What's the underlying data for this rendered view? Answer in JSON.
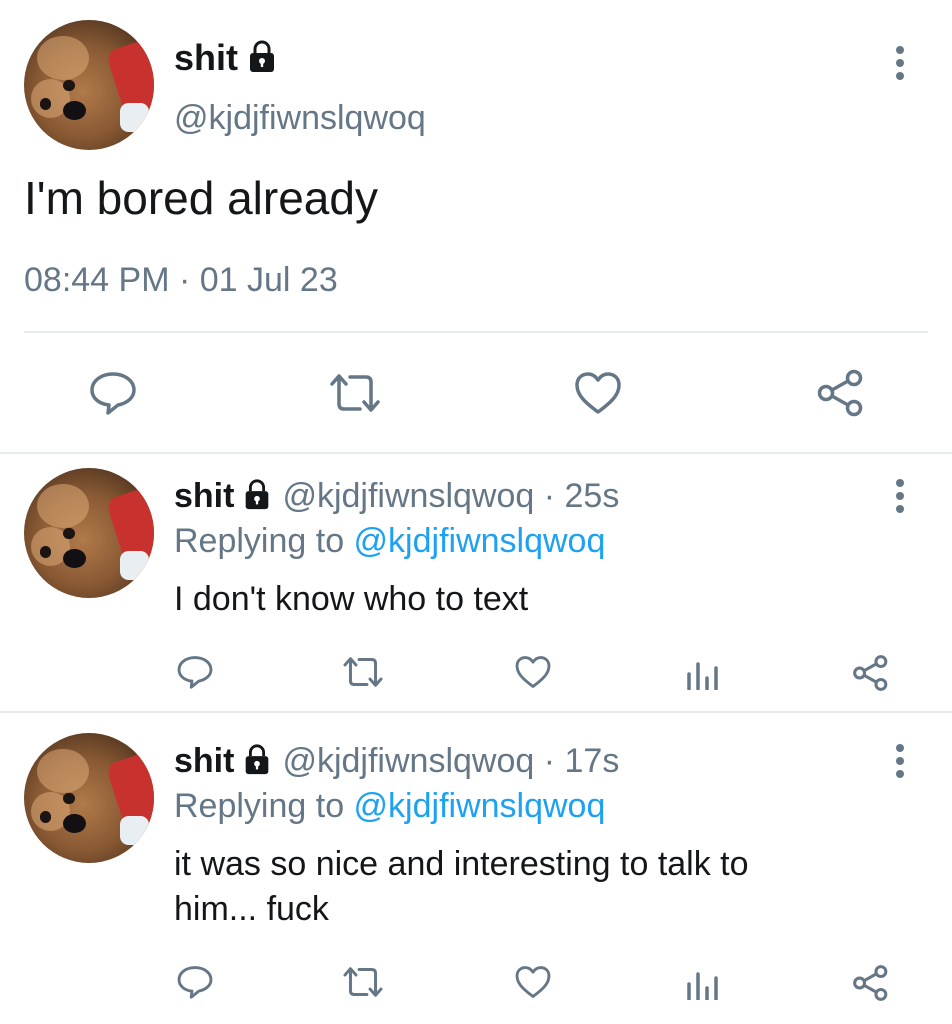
{
  "main_tweet": {
    "display_name": "shit",
    "handle": "@kjdjfiwnslqwoq",
    "text": "I'm bored already",
    "timestamp": "08:44 PM · 01 Jul 23"
  },
  "replies": [
    {
      "display_name": "shit",
      "handle_time": "@kjdjfiwnslqwoq · 25s",
      "replying_prefix": "Replying to ",
      "replying_handle": "@kjdjfiwnslqwoq",
      "text": "I don't know who to text"
    },
    {
      "display_name": "shit",
      "handle_time": "@kjdjfiwnslqwoq · 17s",
      "replying_prefix": "Replying to ",
      "replying_handle": "@kjdjfiwnslqwoq",
      "text_line1": "it was so nice and interesting to talk to",
      "text_line2": "him... fuck"
    }
  ],
  "icons": [
    "lock-icon",
    "more-options-icon",
    "reply-icon",
    "retweet-icon",
    "like-icon",
    "analytics-icon",
    "share-icon"
  ],
  "colors": {
    "text": "#14171a",
    "secondary": "#657786",
    "link": "#1da1f2",
    "divider": "#e6ecf0"
  }
}
